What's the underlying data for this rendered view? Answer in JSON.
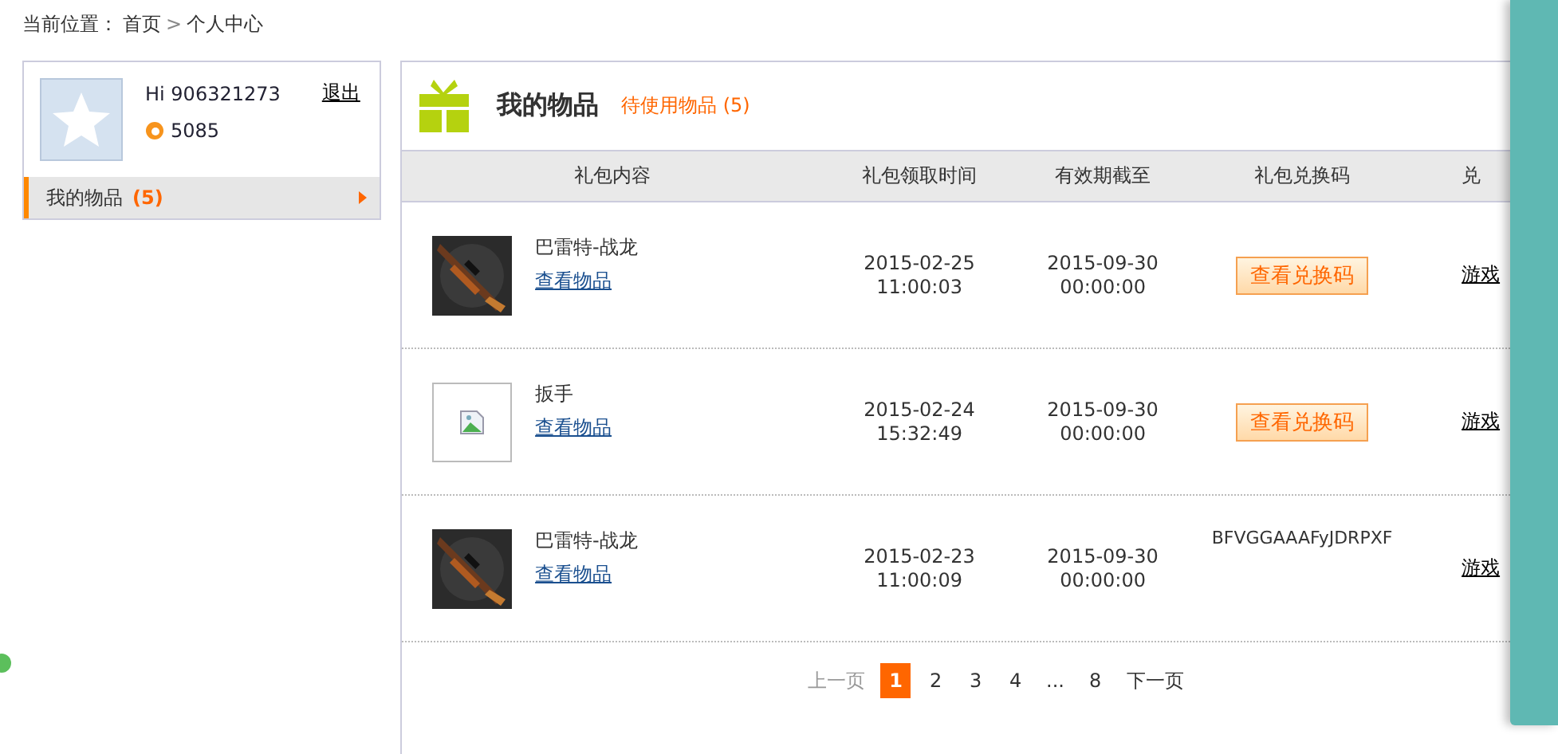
{
  "breadcrumb": {
    "label": "当前位置：",
    "items": [
      "首页",
      "个人中心"
    ],
    "separator": ">"
  },
  "user": {
    "greeting": "Hi 906321273",
    "logout": "退出",
    "points": "5085"
  },
  "sidebar": {
    "items": [
      {
        "label": "我的物品",
        "count": "(5)",
        "selected": true
      }
    ]
  },
  "main": {
    "title": "我的物品",
    "subtitle": "待使用物品 (5)"
  },
  "table": {
    "columns": [
      "礼包内容",
      "礼包领取时间",
      "有效期截至",
      "礼包兑换码",
      "兑"
    ],
    "rows": [
      {
        "kind": "picture",
        "name": "巴雷特-战龙",
        "link": "查看物品",
        "received": [
          "2015-02-25",
          "11:00:03"
        ],
        "expires": [
          "2015-09-30",
          "00:00:00"
        ],
        "code": {
          "kind": "button",
          "text": "查看兑换码"
        },
        "action": "游戏"
      },
      {
        "kind": "broken",
        "name": "扳手",
        "link": "查看物品",
        "received": [
          "2015-02-24",
          "15:32:49"
        ],
        "expires": [
          "2015-09-30",
          "00:00:00"
        ],
        "code": {
          "kind": "button",
          "text": "查看兑换码"
        },
        "action": "游戏"
      },
      {
        "kind": "picture",
        "name": "巴雷特-战龙",
        "link": "查看物品",
        "received": [
          "2015-02-23",
          "11:00:09"
        ],
        "expires": [
          "2015-09-30",
          "00:00:00"
        ],
        "code": {
          "kind": "text",
          "text": "BFVGGAAAFyJDRPXF"
        },
        "action": "游戏"
      }
    ]
  },
  "pagination": {
    "prev": "上一页",
    "pages": [
      {
        "label": "1",
        "selected": true
      },
      {
        "label": "2",
        "selected": false
      },
      {
        "label": "3",
        "selected": false
      },
      {
        "label": "4",
        "selected": false
      },
      {
        "label": "...",
        "selected": false
      },
      {
        "label": "8",
        "selected": false
      }
    ],
    "next": "下一页"
  }
}
